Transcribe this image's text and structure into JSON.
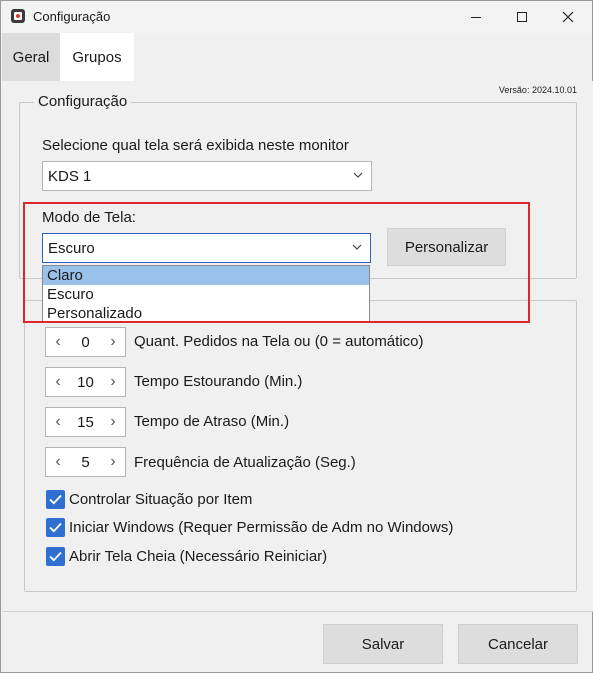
{
  "window": {
    "title": "Configuração"
  },
  "tabs": [
    {
      "label": "Geral"
    },
    {
      "label": "Grupos"
    }
  ],
  "version": "Versão: 2024.10.01",
  "config_group": {
    "legend": "Configuração",
    "monitor_label": "Selecione qual tela será exibida neste monitor",
    "monitor_value": "KDS 1",
    "mode_label": "Modo de Tela:",
    "mode_value": "Escuro",
    "customize_button": "Personalizar",
    "mode_options": [
      "Claro",
      "Escuro",
      "Personalizado"
    ],
    "mode_highlighted_option": "Claro"
  },
  "settings": {
    "steppers": [
      {
        "value": "0",
        "label": "Quant. Pedidos na Tela ou (0 = automático)"
      },
      {
        "value": "10",
        "label": "Tempo Estourando (Min.)"
      },
      {
        "value": "15",
        "label": "Tempo de Atraso (Min.)"
      },
      {
        "value": "5",
        "label": "Frequência de Atualização (Seg.)"
      }
    ],
    "checkboxes": [
      {
        "label": "Controlar Situação por Item",
        "checked": true
      },
      {
        "label": "Iniciar Windows (Requer Permissão de Adm no Windows)",
        "checked": true
      },
      {
        "label": "Abrir Tela Cheia (Necessário Reiniciar)",
        "checked": true
      }
    ]
  },
  "footer": {
    "save_label": "Salvar",
    "cancel_label": "Cancelar"
  },
  "colors": {
    "accent": "#2f6fd1",
    "highlight_frame": "#e0262c",
    "selected_option": "#99c2eb"
  }
}
